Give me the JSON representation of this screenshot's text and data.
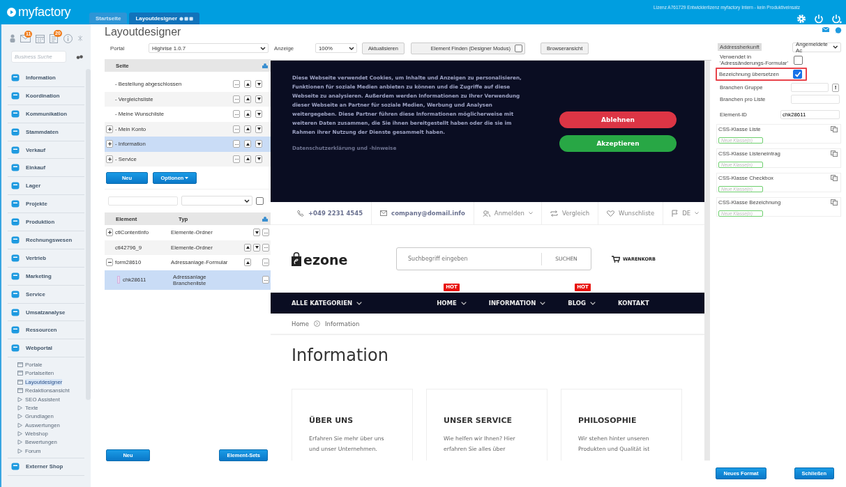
{
  "app": {
    "logo": "myfactory",
    "license": "Lizenz A761729 Entwicklerlizenz myfactory Intern - kein Produktiveinsatz"
  },
  "tabs": [
    {
      "label": "Startseite",
      "selected": false
    },
    {
      "label": "Layoutdesigner",
      "selected": true
    }
  ],
  "sidebar": {
    "badges": [
      "11",
      "20"
    ],
    "search": {
      "placeholder": "Business Suche"
    },
    "items": [
      {
        "label": "Information"
      },
      {
        "label": "Koordination"
      },
      {
        "label": "Kommunikation"
      },
      {
        "label": "Stammdaten"
      },
      {
        "label": "Verkauf"
      },
      {
        "label": "Einkauf"
      },
      {
        "label": "Lager"
      },
      {
        "label": "Projekte"
      },
      {
        "label": "Produktion"
      },
      {
        "label": "Rechnungswesen"
      },
      {
        "label": "Vertrieb"
      },
      {
        "label": "Marketing"
      },
      {
        "label": "Service"
      },
      {
        "label": "Umsatzanalyse"
      },
      {
        "label": "Ressourcen"
      },
      {
        "label": "Webportal",
        "children": [
          {
            "label": "Portale",
            "kind": "page",
            "selected": false
          },
          {
            "label": "Portalseiten",
            "kind": "page",
            "selected": false
          },
          {
            "label": "Layoutdesigner",
            "kind": "page",
            "selected": true
          },
          {
            "label": "Redaktionsansicht",
            "kind": "page",
            "selected": false
          },
          {
            "label": "SEO Assistent",
            "kind": "folder",
            "selected": false
          },
          {
            "label": "Texte",
            "kind": "folder",
            "selected": false
          },
          {
            "label": "Grundlagen",
            "kind": "folder",
            "selected": false
          },
          {
            "label": "Auswertungen",
            "kind": "folder",
            "selected": false
          },
          {
            "label": "Webshop",
            "kind": "folder",
            "selected": false
          },
          {
            "label": "Bewertungen",
            "kind": "folder",
            "selected": false
          },
          {
            "label": "Forum",
            "kind": "folder",
            "selected": false
          }
        ]
      },
      {
        "label": "Externer Shop"
      }
    ]
  },
  "page_title": "Layoutdesigner",
  "portal": {
    "label": "Portal",
    "value": "Highrise 1.0.7"
  },
  "pages_table": {
    "column": "Seite",
    "rows": [
      {
        "label": "- Bestellung abgeschlossen",
        "expandable": false,
        "selected": false
      },
      {
        "label": "- Vergleichsliste",
        "expandable": false,
        "selected": false
      },
      {
        "label": "- Meine Wunschliste",
        "expandable": false,
        "selected": false
      },
      {
        "label": "- Mein Konto",
        "expandable": true,
        "selected": false
      },
      {
        "label": "- Information",
        "expandable": true,
        "selected": true
      },
      {
        "label": "- Service",
        "expandable": true,
        "selected": false
      }
    ]
  },
  "page_buttons": [
    "Neu",
    "Optionen"
  ],
  "element_filter": {
    "checked": false
  },
  "elements_table": {
    "columns": [
      "Element",
      "Typ"
    ],
    "rows": [
      {
        "element": "ctlContentInfo",
        "type": "Elemente-Ordner",
        "kind": "collapsed",
        "up": false,
        "down": true,
        "selected": false
      },
      {
        "element": "ctl42796_9",
        "type": "Elemente-Ordner",
        "kind": "item",
        "up": true,
        "down": true,
        "selected": false
      },
      {
        "element": "form28610",
        "type": "Adressanlage-Formular",
        "kind": "expanded",
        "up": true,
        "down": false,
        "selected": false
      },
      {
        "element": "chk28611",
        "type": "Adressanlage Branchenliste",
        "kind": "field",
        "up": false,
        "down": false,
        "selected": true
      }
    ]
  },
  "element_buttons": [
    "Neu",
    "Element-Sets"
  ],
  "toolbar": {
    "zoom_label": "Anzeige",
    "zoom": "100%",
    "refresh": "Aktualisieren",
    "find": {
      "label": "Element Finden (Designer Modus)",
      "checked": false
    },
    "browser_view": "Browseransicht"
  },
  "preview": {
    "cookie": {
      "text": "Diese Webseite verwendet Cookies, um Inhalte und Anzeigen zu personalisieren, Funktionen für soziale Medien anbieten zu können und die Zugriffe auf diese Webseite zu analysieren. Außerdem werden Informationen zu Ihrer Verwendung dieser Webseite an Partner für soziale Medien, Werbung und Analysen weitergegeben. Diese Partner führen diese Informationen möglicherweise mit weiteren Daten zusammen, die Sie ihnen bereitgestellt haben oder die sie im Rahmen ihrer Nutzung der Dienste gesammelt haben.",
      "link": "Datenschutzerklärung und -hinweise",
      "buttons": [
        {
          "label": "Ablehnen",
          "kind": "decline"
        },
        {
          "label": "Akzeptieren",
          "kind": "accept"
        }
      ]
    },
    "topbar": [
      {
        "kind": "phone",
        "text": "+049 2231 4545",
        "dropdown": false
      },
      {
        "kind": "mail",
        "text": "company@domail.info",
        "dropdown": false
      },
      {
        "kind": "user",
        "text": "Anmelden",
        "dropdown": true
      },
      {
        "kind": "compare",
        "text": "Vergleich",
        "dropdown": false
      },
      {
        "kind": "heart",
        "text": "Wunschliste",
        "dropdown": false
      },
      {
        "kind": "flag",
        "text": "DE",
        "dropdown": true
      }
    ],
    "logo": "ezone",
    "search": {
      "placeholder": "Suchbegriff eingeben",
      "button": "SUCHEN"
    },
    "cart": "WARENKORB",
    "nav": [
      {
        "label": "ALLE KATEGORIEN",
        "dropdown": true
      },
      {
        "label": "HOME",
        "dropdown": true,
        "badge": "HOT"
      },
      {
        "label": "INFORMATION",
        "dropdown": true
      },
      {
        "label": "BLOG",
        "dropdown": true,
        "badge": "HOT"
      },
      {
        "label": "KONTAKT",
        "dropdown": false
      }
    ],
    "breadcrumb": [
      "Home",
      "Information"
    ],
    "heading": "Information",
    "cards": [
      {
        "title": "ÜBER UNS",
        "text": "Erfahren Sie mehr über uns und unser Unternehmen."
      },
      {
        "title": "UNSER SERVICE",
        "text": "Wie helfen wir Ihnen? Hier erfahren Sie alles über"
      },
      {
        "title": "PHILOSOPHIE",
        "text": "Wir stehen hinter unseren Produkten und Qualität ist"
      }
    ]
  },
  "properties": [
    {
      "kind": "select",
      "label": "Addressherkunft",
      "value": "Angemeldete Ac"
    },
    {
      "kind": "checkbox",
      "label": "Verwendet in 'Adressänderungs-Formular'",
      "checked": false,
      "highlighted": false
    },
    {
      "kind": "checkbox",
      "label": "Bezeichnung übersetzen",
      "checked": true,
      "highlighted": true
    },
    {
      "kind": "lookup",
      "label": "Branchen Gruppe",
      "button": "!"
    },
    {
      "kind": "text",
      "label": "Branchen pro Liste"
    },
    {
      "kind": "id",
      "label": "Element-ID",
      "value": "chk28611"
    }
  ],
  "css_classes": [
    {
      "label": "CSS-Klasse Liste",
      "placeholder": "Neue Klasse(n)"
    },
    {
      "label": "CSS-Klasse Listeneintrag",
      "placeholder": "Neue Klasse(n)"
    },
    {
      "label": "CSS-Klasse Checkbox",
      "placeholder": "Neue Klasse(n)"
    },
    {
      "label": "CSS-Klasse Bezeichnung",
      "placeholder": "Neue Klasse(n)"
    }
  ],
  "footer_buttons": [
    "Neues Format",
    "Schließen"
  ]
}
